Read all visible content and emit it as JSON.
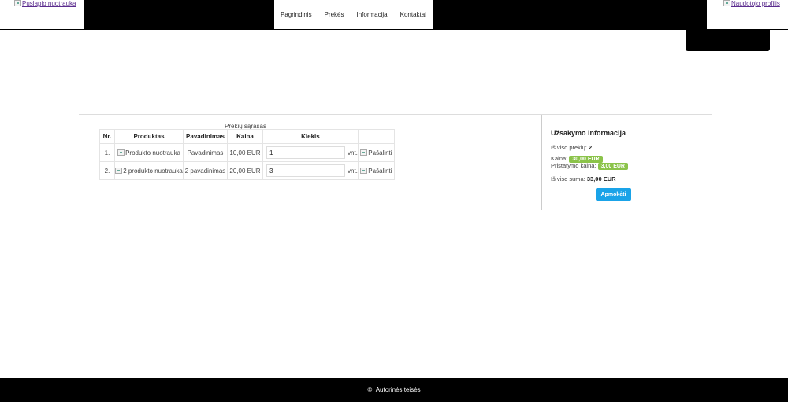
{
  "header": {
    "logo_alt": "Puslapio nuotrauka",
    "nav": [
      "Pagrindinis",
      "Prekės",
      "Informacija",
      "Kontaktai"
    ],
    "profile_alt": "Naudotojo profilis"
  },
  "cart": {
    "caption": "Prekių sąrašas",
    "columns": [
      "Nr.",
      "Produktas",
      "Pavadinimas",
      "Kaina",
      "Kiekis",
      ""
    ],
    "rows": [
      {
        "nr": "1.",
        "image_alt": "Produkto nuotrauka",
        "name": "Pavadinimas",
        "price": "10,00 EUR",
        "qty": "1",
        "unit": "vnt.",
        "remove_alt": "Pašalinti"
      },
      {
        "nr": "2.",
        "image_alt": "2 produkto nuotrauka",
        "name": "2 pavadinimas",
        "price": "20,00 EUR",
        "qty": "3",
        "unit": "vnt.",
        "remove_alt": "Pašalinti"
      }
    ]
  },
  "summary": {
    "title": "Užsakymo informacija",
    "total_items_label": "Iš viso prekių:",
    "total_items_value": "2",
    "price_label": "Kaina:",
    "price_value": "30,00 EUR",
    "shipping_label": "Pristatymo kaina:",
    "shipping_value": "3,00 EUR",
    "total_sum_label": "Iš viso suma:",
    "total_sum_value": "33,00 EUR",
    "pay_button": "Apmokėti"
  },
  "footer": {
    "copyright_symbol": "©",
    "copyright_text": "Autorinės teisės"
  },
  "colors": {
    "header_bg": "#000000",
    "badge_green": "#8bc34a",
    "pay_blue": "#1aa3e8",
    "link_purple": "#5b2c8e"
  }
}
